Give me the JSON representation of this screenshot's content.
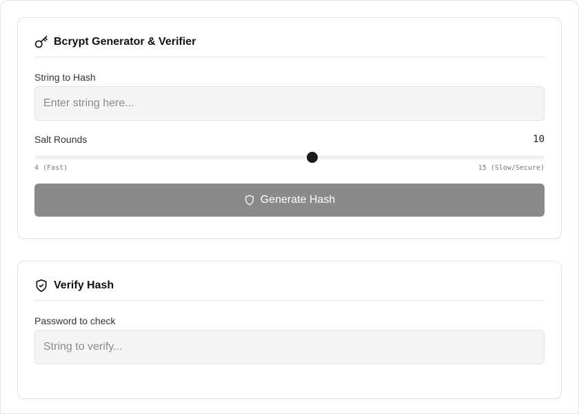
{
  "generator": {
    "title": "Bcrypt Generator & Verifier",
    "icon": "key-icon",
    "input_label": "String to Hash",
    "input_placeholder": "Enter string here...",
    "input_value": "",
    "salt_label": "Salt Rounds",
    "salt_value": "10",
    "salt_min": 4,
    "salt_max": 15,
    "salt_current": 10,
    "salt_min_label": "4 (Fast)",
    "salt_max_label": "15 (Slow/Secure)",
    "button_label": "Generate Hash",
    "button_icon": "shield-icon"
  },
  "verifier": {
    "title": "Verify Hash",
    "icon": "shield-check-icon",
    "input_label": "Password to check",
    "input_placeholder": "String to verify...",
    "input_value": ""
  },
  "colors": {
    "button_disabled": "#8a8a8a",
    "slider_thumb": "#1a1a1a",
    "input_bg": "#f5f5f5"
  }
}
